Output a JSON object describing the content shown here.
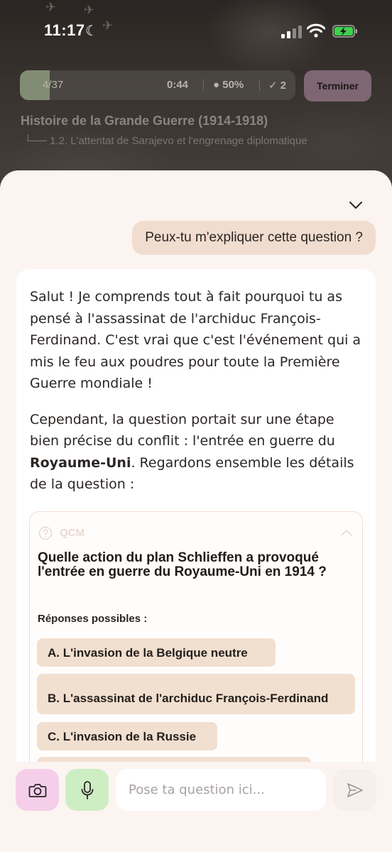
{
  "status_bar": {
    "time": "11:17"
  },
  "quiz_header": {
    "progress_count": "4/37",
    "progress_fraction": 0.108,
    "timer": "0:44",
    "score": "50%",
    "correct_count": "2",
    "finish_label": "Terminer",
    "course_title": "Histoire de la Grande Guerre (1914-1918)",
    "chapter": "1.2. L'attentat de Sarajevo et l'engrenage diplomatique"
  },
  "chat": {
    "user_message": "Peux-tu m'expliquer cette question ?",
    "ai_paragraph_1": "Salut ! Je comprends tout à fait pourquoi tu as pensé à l'assassinat de l'archiduc François-Ferdinand. C'est vrai que c'est l'événement qui a mis le feu aux poudres pour toute la Première Guerre mondiale !",
    "ai_paragraph_2_start": "Cependant, la question portait sur une étape bien précise du conflit : l'entrée en guerre du ",
    "ai_paragraph_2_bold": "Royaume-Uni",
    "ai_paragraph_2_end": ". Regardons ensemble les détails de la question :"
  },
  "qcm": {
    "label": "QCM",
    "question": "Quelle action du plan Schlieffen a provoqué l'entrée en guerre du Royaume-Uni en 1914 ?",
    "answers_label": "Réponses possibles :",
    "answers": [
      "A. L'invasion de la Belgique neutre",
      "B. L'assassinat de l'archiduc François-Ferdinand",
      "C. L'invasion de la Russie",
      ""
    ]
  },
  "input_bar": {
    "placeholder": "Pose ta question ici..."
  },
  "colors": {
    "sheet_bg": "#fbf4f1",
    "user_bubble": "#f1ddd0",
    "answer_bg": "#f1dfcf",
    "camera_btn": "#f5cfea",
    "mic_btn": "#cdeec3",
    "finish_btn": "#7e6672",
    "progress_fill": "#8a9a7d"
  },
  "icons": {
    "camera": "camera-icon",
    "mic": "microphone-icon",
    "send": "send-icon",
    "collapse": "chevron-down-icon",
    "qcm": "question-circle-icon"
  }
}
